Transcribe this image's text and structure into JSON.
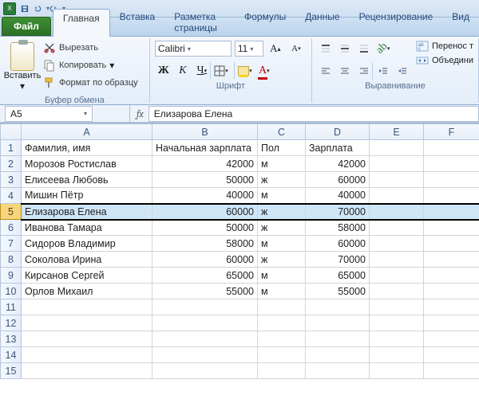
{
  "qat": {
    "app_label": "X"
  },
  "tabs": {
    "file": "Файл",
    "items": [
      "Главная",
      "Вставка",
      "Разметка страницы",
      "Формулы",
      "Данные",
      "Рецензирование",
      "Вид"
    ],
    "active_index": 0
  },
  "ribbon": {
    "clipboard": {
      "paste": "Вставить",
      "cut": "Вырезать",
      "copy": "Копировать",
      "format_painter": "Формат по образцу",
      "group_label": "Буфер обмена"
    },
    "font": {
      "font_name": "Calibri",
      "font_size": "11",
      "group_label": "Шрифт",
      "bold": "Ж",
      "italic": "К",
      "underline": "Ч"
    },
    "alignment": {
      "wrap": "Перенос т",
      "merge": "Объедини",
      "group_label": "Выравнивание"
    }
  },
  "namebox": "A5",
  "fx_label": "fx",
  "formula_value": "Елизарова Елена",
  "columns": [
    "A",
    "B",
    "C",
    "D",
    "E",
    "F"
  ],
  "selected_row_index": 4,
  "active_col_index": 0,
  "rows": [
    {
      "n": 1,
      "A": "Фамилия, имя",
      "B": "Начальная зарплата",
      "C": "Пол",
      "D": "Зарплата",
      "E": "",
      "F": "",
      "Bnum": false,
      "Dnum": false
    },
    {
      "n": 2,
      "A": "Морозов Ростислав",
      "B": "42000",
      "C": "м",
      "D": "42000",
      "E": "",
      "F": "",
      "Bnum": true,
      "Dnum": true
    },
    {
      "n": 3,
      "A": "Елисеева Любовь",
      "B": "50000",
      "C": "ж",
      "D": "60000",
      "E": "",
      "F": "",
      "Bnum": true,
      "Dnum": true
    },
    {
      "n": 4,
      "A": "Мишин Пётр",
      "B": "40000",
      "C": "м",
      "D": "40000",
      "E": "",
      "F": "",
      "Bnum": true,
      "Dnum": true
    },
    {
      "n": 5,
      "A": "Елизарова Елена",
      "B": "60000",
      "C": "ж",
      "D": "70000",
      "E": "",
      "F": "",
      "Bnum": true,
      "Dnum": true
    },
    {
      "n": 6,
      "A": "Иванова Тамара",
      "B": "50000",
      "C": "ж",
      "D": "58000",
      "E": "",
      "F": "",
      "Bnum": true,
      "Dnum": true
    },
    {
      "n": 7,
      "A": "Сидоров Владимир",
      "B": "58000",
      "C": "м",
      "D": "60000",
      "E": "",
      "F": "",
      "Bnum": true,
      "Dnum": true
    },
    {
      "n": 8,
      "A": "Соколова Ирина",
      "B": "60000",
      "C": "ж",
      "D": "70000",
      "E": "",
      "F": "",
      "Bnum": true,
      "Dnum": true
    },
    {
      "n": 9,
      "A": "Кирсанов Сергей",
      "B": "65000",
      "C": "м",
      "D": "65000",
      "E": "",
      "F": "",
      "Bnum": true,
      "Dnum": true
    },
    {
      "n": 10,
      "A": "Орлов Михаил",
      "B": "55000",
      "C": "м",
      "D": "55000",
      "E": "",
      "F": "",
      "Bnum": true,
      "Dnum": true
    },
    {
      "n": 11,
      "A": "",
      "B": "",
      "C": "",
      "D": "",
      "E": "",
      "F": ""
    },
    {
      "n": 12,
      "A": "",
      "B": "",
      "C": "",
      "D": "",
      "E": "",
      "F": ""
    },
    {
      "n": 13,
      "A": "",
      "B": "",
      "C": "",
      "D": "",
      "E": "",
      "F": ""
    },
    {
      "n": 14,
      "A": "",
      "B": "",
      "C": "",
      "D": "",
      "E": "",
      "F": ""
    },
    {
      "n": 15,
      "A": "",
      "B": "",
      "C": "",
      "D": "",
      "E": "",
      "F": ""
    }
  ]
}
